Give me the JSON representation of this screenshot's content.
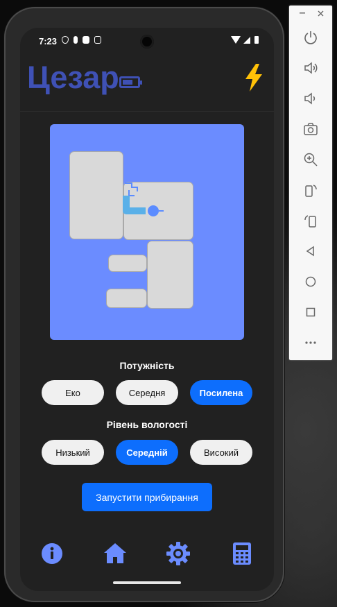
{
  "status": {
    "time": "7:23"
  },
  "app": {
    "title": "Цезар"
  },
  "sections": {
    "power": {
      "title": "Потужність",
      "options": [
        "Еко",
        "Середня",
        "Посилена"
      ],
      "selected": "Посилена"
    },
    "humidity": {
      "title": "Рівень вологості",
      "options": [
        "Низький",
        "Середній",
        "Високий"
      ],
      "selected": "Середній"
    }
  },
  "start_button": "Запустити прибирання",
  "nav": {
    "items": [
      "info-icon",
      "home-icon",
      "settings-gear-icon",
      "calculator-icon"
    ]
  },
  "emulator_panel": {
    "buttons": [
      "power-icon",
      "volume-up-icon",
      "volume-down-icon",
      "rotate-left-icon",
      "rotate-right-icon",
      "camera-icon",
      "zoom-icon",
      "back-icon",
      "home-circle-icon",
      "overview-icon",
      "more-icon"
    ]
  },
  "colors": {
    "accent": "#3f51b5",
    "primary_button": "#0d6efd",
    "map_bg": "#6b8cff",
    "bolt": "#ffc107",
    "robot": "#5b8cff"
  }
}
